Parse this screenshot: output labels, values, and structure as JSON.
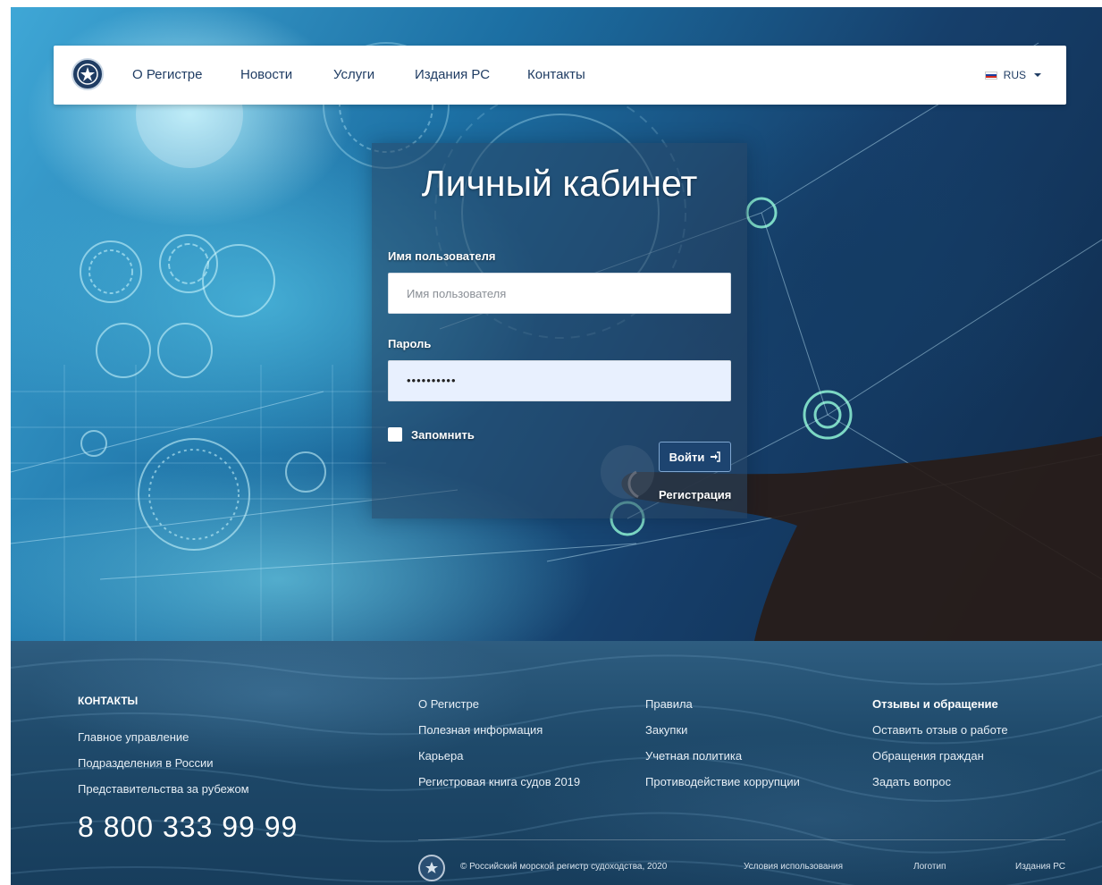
{
  "nav": {
    "items": [
      "О Регистре",
      "Новости",
      "Услуги",
      "Издания РС",
      "Контакты"
    ],
    "language": "RUS",
    "logo_icon": "rs-emblem-icon"
  },
  "login": {
    "title": "Личный кабинет",
    "username_label": "Имя пользователя",
    "username_placeholder": "Имя пользователя",
    "password_label": "Пароль",
    "password_value": "••••••••••",
    "remember_label": "Запомнить",
    "login_button": "Войти",
    "login_icon": "sign-in-icon",
    "register_link": "Регистрация"
  },
  "footer": {
    "contacts_heading": "КОНТАКТЫ",
    "contacts_links": [
      "Главное управление",
      "Подразделения в России",
      "Представительства за рубежом"
    ],
    "phone": "8 800 333 99 99",
    "col2": [
      "О Регистре",
      "Полезная информация",
      "Карьера",
      "Регистровая книга судов 2019"
    ],
    "col3": [
      "Правила",
      "Закупки",
      "Учетная политика",
      "Противодействие коррупции"
    ],
    "col4_heading": "Отзывы и обращение",
    "col4": [
      "Оставить отзыв о работе",
      "Обращения граждан",
      "Задать вопрос"
    ],
    "copyright": "© Российский морской регистр судоходства, 2020",
    "bottom_links": [
      "Условия использования",
      "Логотип",
      "Издания РС"
    ]
  },
  "colors": {
    "brand_navy": "#1f3c63",
    "footer_sea": "#1f4a6b",
    "button_bg": "#1d4470"
  }
}
